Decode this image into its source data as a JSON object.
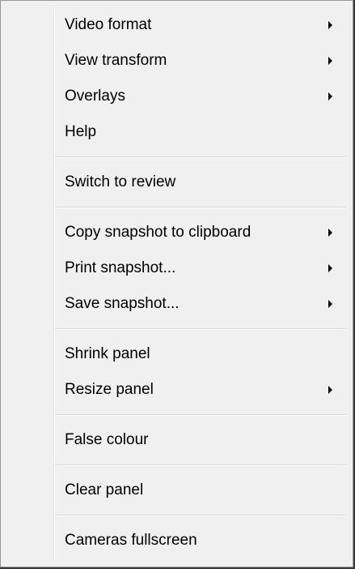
{
  "menu": {
    "groups": [
      {
        "items": [
          {
            "label": "Video format",
            "submenu": true
          },
          {
            "label": "View transform",
            "submenu": true
          },
          {
            "label": "Overlays",
            "submenu": true
          },
          {
            "label": "Help",
            "submenu": false
          }
        ]
      },
      {
        "items": [
          {
            "label": "Switch to review",
            "submenu": false
          }
        ]
      },
      {
        "items": [
          {
            "label": "Copy snapshot to clipboard",
            "submenu": true
          },
          {
            "label": "Print snapshot...",
            "submenu": true
          },
          {
            "label": "Save snapshot...",
            "submenu": true
          }
        ]
      },
      {
        "items": [
          {
            "label": "Shrink panel",
            "submenu": false
          },
          {
            "label": "Resize panel",
            "submenu": true
          }
        ]
      },
      {
        "items": [
          {
            "label": "False colour",
            "submenu": false
          }
        ]
      },
      {
        "items": [
          {
            "label": "Clear panel",
            "submenu": false
          }
        ]
      },
      {
        "items": [
          {
            "label": "Cameras fullscreen",
            "submenu": false
          }
        ]
      }
    ]
  }
}
